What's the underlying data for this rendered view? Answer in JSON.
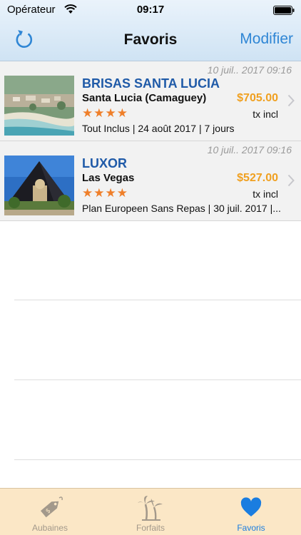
{
  "status_bar": {
    "carrier": "Opérateur",
    "time": "09:17"
  },
  "nav": {
    "title": "Favoris",
    "edit_label": "Modifier"
  },
  "favorites": [
    {
      "date": "10 juil.. 2017 09:16",
      "name": "BRISAS SANTA LUCIA",
      "city": "Santa Lucia (Camaguey)",
      "price": "$705.00",
      "tax": "tx incl",
      "stars": "★★★★",
      "description": "Tout Inclus | 24 août 2017 | 7 jours",
      "image": "beach-resort-aerial-photo"
    },
    {
      "date": "10 juil.. 2017 09:16",
      "name": "LUXOR",
      "city": "Las Vegas",
      "price": "$527.00",
      "tax": "tx incl",
      "stars": "★★★★",
      "description": "Plan Europeen Sans Repas | 30 juil. 2017 |...",
      "image": "luxor-pyramid-hotel-photo"
    }
  ],
  "tabbar": {
    "tabs": [
      {
        "label": "Aubaines",
        "icon": "price-tag-icon",
        "active": false
      },
      {
        "label": "Forfaits",
        "icon": "palm-tree-icon",
        "active": false
      },
      {
        "label": "Favoris",
        "icon": "heart-icon",
        "active": true
      }
    ]
  },
  "colors": {
    "accent": "#2f86d5",
    "hotel_name": "#1f5aa8",
    "price": "#f0a020",
    "stars": "#ef7f2a",
    "tabbar_bg": "#fbe7c6"
  }
}
